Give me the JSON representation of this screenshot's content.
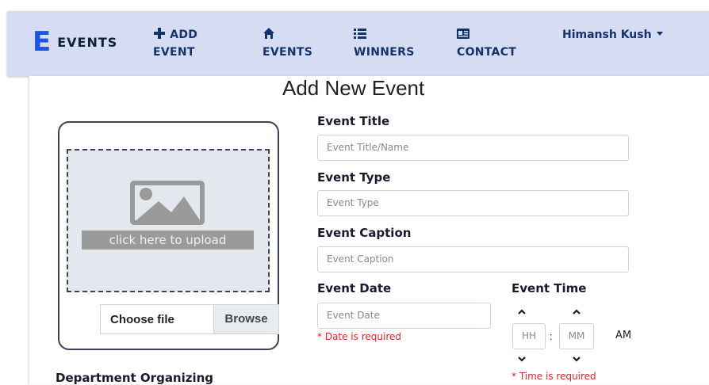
{
  "navbar": {
    "brand_letter": "E",
    "brand_text": "EVENTS",
    "items": [
      {
        "label_line1": "ADD",
        "label_line2": "EVENT",
        "icon": "plus-icon"
      },
      {
        "label_line1": "",
        "label_line2": "EVENTS",
        "icon": "home-icon"
      },
      {
        "label_line1": "",
        "label_line2": "WINNERS",
        "icon": "list-icon"
      },
      {
        "label_line1": "",
        "label_line2": "CONTACT",
        "icon": "contact-card-icon"
      }
    ],
    "user_name": "Himansh Kush"
  },
  "form": {
    "title": "Add New Event",
    "upload_label": "click here to upload",
    "file_choose": "Choose file",
    "file_browse": "Browse",
    "event_title_label": "Event Title",
    "event_title_placeholder": "Event Title/Name",
    "event_type_label": "Event Type",
    "event_type_placeholder": "Event Type",
    "event_caption_label": "Event Caption",
    "event_caption_placeholder": "Event Caption",
    "event_date_label": "Event Date",
    "event_date_placeholder": "Event Date",
    "date_error": "* Date is required",
    "event_time_label": "Event Time",
    "hours_placeholder": "HH",
    "minutes_placeholder": "MM",
    "separator": ":",
    "meridian": "AM",
    "time_error": "* Time is required",
    "department_label": "Department Organizing"
  }
}
